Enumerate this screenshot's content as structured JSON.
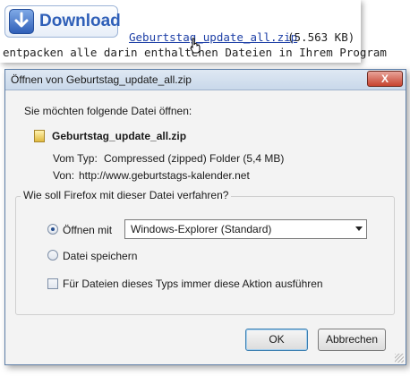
{
  "web": {
    "download_label": "Download",
    "zip_link": "Geburtstag_update_all.zip",
    "zip_size": "(5.563 KB)",
    "line_text": "entpacken alle darin enthaltenen Dateien in Ihrem Program"
  },
  "dialog": {
    "title": "Öffnen von Geburtstag_update_all.zip",
    "close_label": "X",
    "prompt": "Sie möchten folgende Datei öffnen:",
    "file_name": "Geburtstag_update_all.zip",
    "type_label": "Vom Typ:",
    "type_value": "Compressed (zipped) Folder (5,4 MB)",
    "from_label": "Von:",
    "from_value": "http://www.geburtstags-kalender.net",
    "group_title": "Wie soll Firefox mit dieser Datei verfahren?",
    "open_with_label": "Öffnen mit",
    "open_with_value": "Windows-Explorer (Standard)",
    "save_label": "Datei speichern",
    "always_label": "Für Dateien dieses Typs immer diese Aktion ausführen",
    "ok_label": "OK",
    "cancel_label": "Abbrechen"
  },
  "colors": {
    "titlebar": "#c9d8ea",
    "link": "#1d3fa6",
    "download_accent": "#2f5fb8"
  },
  "state": {
    "open_with_selected": true,
    "save_selected": false,
    "always_checked": false
  }
}
